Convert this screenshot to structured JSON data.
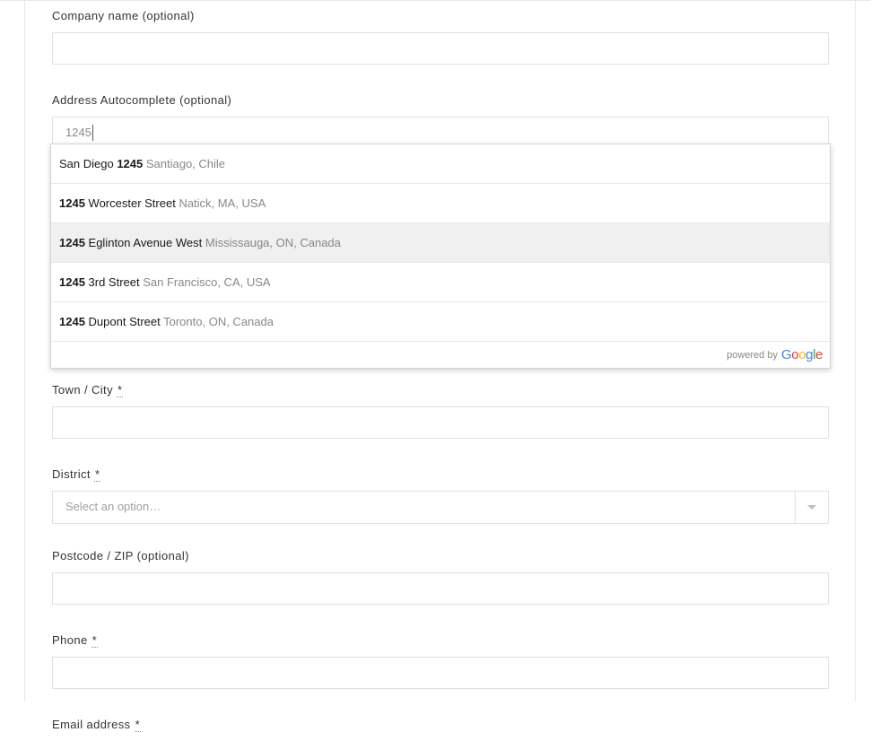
{
  "form": {
    "company": {
      "label": "Company name",
      "optional": "(optional)",
      "value": ""
    },
    "address_ac": {
      "label": "Address Autocomplete",
      "optional": "(optional)",
      "value": "1245"
    },
    "city": {
      "label": "Town / City",
      "required": "*",
      "value": ""
    },
    "district": {
      "label": "District",
      "required": "*",
      "placeholder": "Select an option…"
    },
    "postcode": {
      "label": "Postcode / ZIP",
      "optional": "(optional)",
      "value": ""
    },
    "phone": {
      "label": "Phone",
      "required": "*",
      "value": ""
    },
    "email": {
      "label": "Email address",
      "required": "*"
    }
  },
  "autocomplete": {
    "items": [
      {
        "pre": "San Diego ",
        "match": "1245",
        "post": "",
        "secondary": " Santiago, Chile",
        "hover": false
      },
      {
        "pre": "",
        "match": "1245",
        "post": " Worcester Street",
        "secondary": " Natick, MA, USA",
        "hover": false
      },
      {
        "pre": "",
        "match": "1245",
        "post": " Eglinton Avenue West",
        "secondary": " Mississauga, ON, Canada",
        "hover": true
      },
      {
        "pre": "",
        "match": "1245",
        "post": " 3rd Street",
        "secondary": " San Francisco, CA, USA",
        "hover": false
      },
      {
        "pre": "",
        "match": "1245",
        "post": " Dupont Street",
        "secondary": " Toronto, ON, Canada",
        "hover": false
      }
    ],
    "powered_by": "powered by",
    "google": {
      "g": "G",
      "o1": "o",
      "o2": "o",
      "g2": "g",
      "l": "l",
      "e": "e"
    }
  }
}
